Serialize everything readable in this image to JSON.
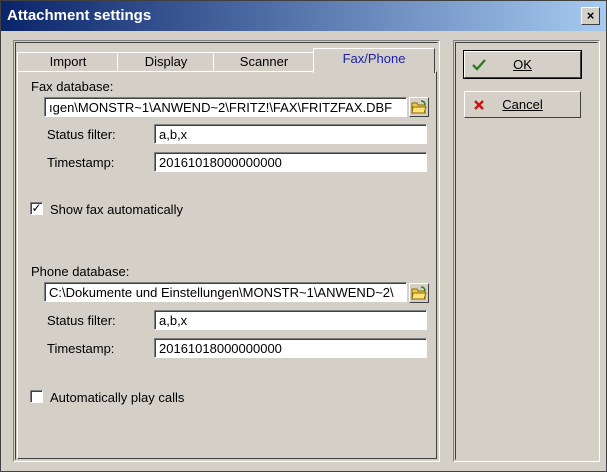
{
  "window": {
    "title": "Attachment settings",
    "close_glyph": "×"
  },
  "tabs": [
    "Import",
    "Display",
    "Scanner",
    "Fax/Phone"
  ],
  "fax": {
    "db_label": "Fax database:",
    "db_value": "ıgen\\MONSTR~1\\ANWEND~2\\FRITZ!\\FAX\\FRITZFAX.DBF",
    "status_label": "Status filter:",
    "status_value": "a,b,x",
    "timestamp_label": "Timestamp:",
    "timestamp_value": "20161018000000000",
    "show_auto_label": "Show fax automatically",
    "show_auto_checked": true
  },
  "phone": {
    "db_label": "Phone database:",
    "db_value": "C:\\Dokumente und Einstellungen\\MONSTR~1\\ANWEND~2\\",
    "status_label": "Status filter:",
    "status_value": "a,b,x",
    "timestamp_label": "Timestamp:",
    "timestamp_value": "20161018000000000",
    "auto_play_label": "Automatically play calls",
    "auto_play_checked": false
  },
  "buttons": {
    "ok": "OK",
    "cancel": "Cancel"
  },
  "colors": {
    "active_tab": "#1a23a8",
    "ok_check": "#2e7d1a",
    "cancel_x": "#d01010"
  },
  "icons": {
    "browse": "folder-open-icon",
    "ok": "checkmark-icon",
    "cancel": "red-x-icon"
  }
}
